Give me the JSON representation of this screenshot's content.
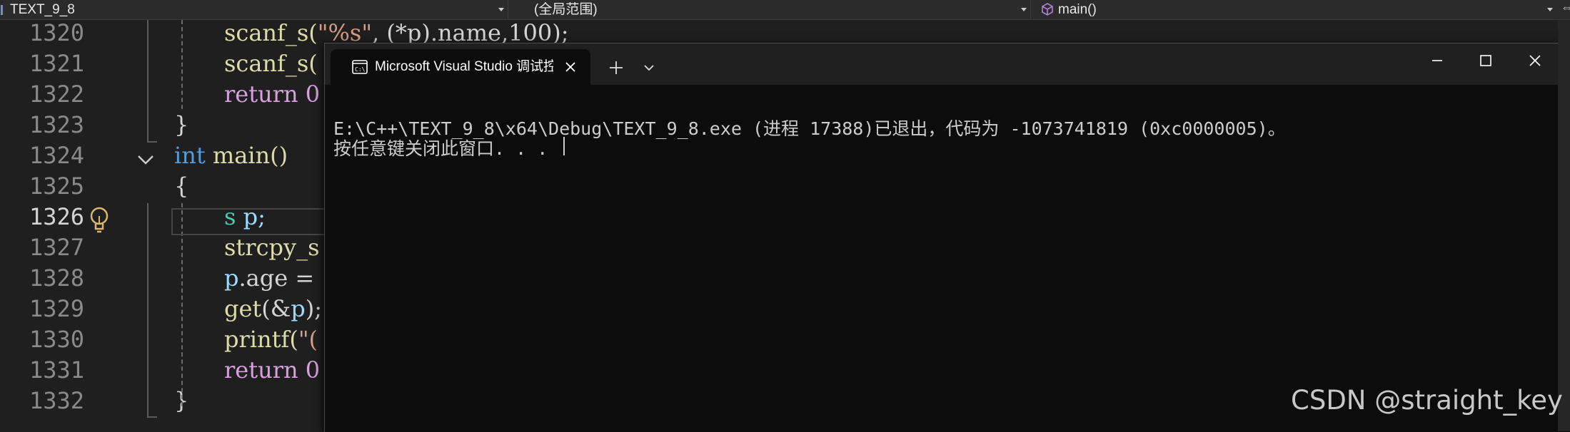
{
  "navbar": {
    "project": "TEXT_9_8",
    "scope": "(全局范围)",
    "function": "main()"
  },
  "editor": {
    "lines": [
      {
        "num": "1320",
        "code": [
          {
            "t": "scanf_s(",
            "c": "#dcdcaa"
          },
          {
            "t": "\"%s\"",
            "c": "#d69d85"
          },
          {
            "t": ", (*p).name,100);",
            "c": "#d4d4d4"
          }
        ]
      },
      {
        "num": "1321",
        "code": [
          {
            "t": "scanf_s(",
            "c": "#dcdcaa"
          }
        ]
      },
      {
        "num": "1322",
        "code": [
          {
            "t": "return 0",
            "c": "#d8a0df"
          }
        ]
      },
      {
        "num": "1323",
        "code": [
          {
            "t": "}",
            "c": "#d4d4d4"
          }
        ]
      },
      {
        "num": "1324",
        "code": [
          {
            "t": "int",
            "c": "#569cd6"
          },
          {
            "t": " main()",
            "c": "#dcdcaa"
          }
        ]
      },
      {
        "num": "1325",
        "code": [
          {
            "t": "{",
            "c": "#d4d4d4"
          }
        ]
      },
      {
        "num": "1326",
        "code": [
          {
            "t": "s",
            "c": "#4ec9b0"
          },
          {
            "t": " p;",
            "c": "#9cdcfe"
          }
        ]
      },
      {
        "num": "1327",
        "code": [
          {
            "t": "strcpy_s",
            "c": "#dcdcaa"
          }
        ]
      },
      {
        "num": "1328",
        "code": [
          {
            "t": "p",
            "c": "#9cdcfe"
          },
          {
            "t": ".age = ",
            "c": "#d4d4d4"
          }
        ]
      },
      {
        "num": "1329",
        "code": [
          {
            "t": "get",
            "c": "#dcdcaa"
          },
          {
            "t": "(&",
            "c": "#d4d4d4"
          },
          {
            "t": "p",
            "c": "#9cdcfe"
          },
          {
            "t": ");",
            "c": "#d4d4d4"
          }
        ]
      },
      {
        "num": "1330",
        "code": [
          {
            "t": "printf(",
            "c": "#dcdcaa"
          },
          {
            "t": "\"(",
            "c": "#d69d85"
          }
        ]
      },
      {
        "num": "1331",
        "code": [
          {
            "t": "return 0",
            "c": "#d8a0df"
          }
        ]
      },
      {
        "num": "1332",
        "code": [
          {
            "t": "}",
            "c": "#d4d4d4"
          }
        ]
      }
    ]
  },
  "console": {
    "tab_title": "Microsoft Visual Studio 调试控制台",
    "output_line1": "E:\\C++\\TEXT_9_8\\x64\\Debug\\TEXT_9_8.exe (进程 17388)已退出，代码为 -1073741819 (0xc0000005)。",
    "output_line2": "按任意键关闭此窗口. . ."
  },
  "watermark": "CSDN @straight_key",
  "colors": {
    "editor_bg": "#1f1f1f",
    "console_bg": "#0c0c0c",
    "keyword": "#569cd6",
    "function": "#dcdcaa",
    "string": "#d69d85",
    "type": "#4ec9b0",
    "variable": "#9cdcfe",
    "control": "#d8a0df"
  }
}
